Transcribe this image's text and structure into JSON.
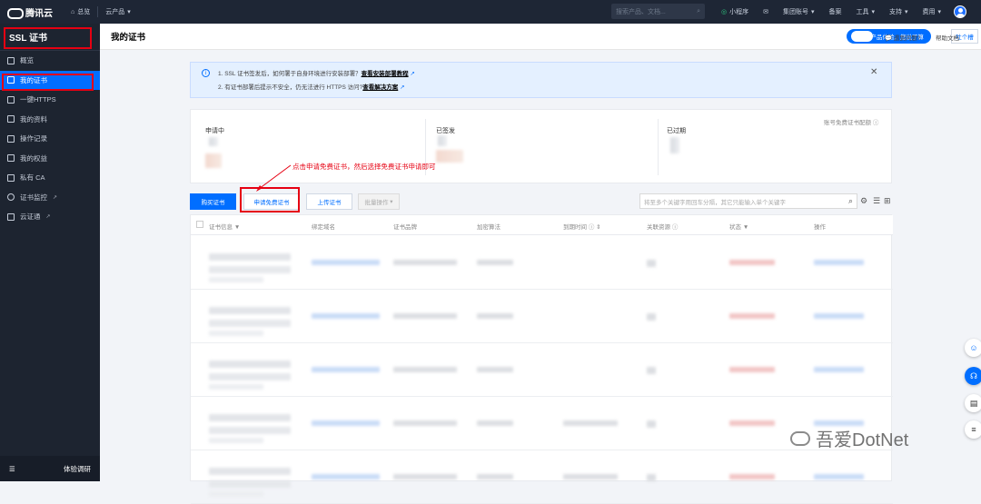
{
  "topbar": {
    "brand": "腾讯云",
    "overview": "总览",
    "products": "云产品",
    "search_placeholder": "搜索产品、文档...",
    "mini_program": "小程序",
    "team_account": "集团账号",
    "record": "备案",
    "tools": "工具",
    "support": "支持",
    "billing": "费用"
  },
  "sidebar": {
    "title": "SSL 证书",
    "items": [
      {
        "label": "概览"
      },
      {
        "label": "我的证书"
      },
      {
        "label": "一键HTTPS"
      },
      {
        "label": "我的资料"
      },
      {
        "label": "操作记录"
      },
      {
        "label": "我的权益"
      },
      {
        "label": "私有 CA"
      },
      {
        "label": "证书监控"
      },
      {
        "label": "云证通"
      }
    ],
    "bottom_label": "体验调研"
  },
  "header": {
    "title": "我的证书",
    "promo": "产品体验，您说了算",
    "tucao": "吐个槽",
    "question": "遇到问题?",
    "help": "帮助文档"
  },
  "notice": {
    "line1": "1. SSL 证书签发后，如何署于自身环境进行安装部署？",
    "line1_link": "查看安装部署教程",
    "line2": "2. 有证书部署后提示不安全，仍无法进行 HTTPS 访问?",
    "line2_link": "查看解决方案"
  },
  "stats": {
    "applying": "申请中",
    "issued": "已签发",
    "expired": "已过期",
    "quota_link": "账号免费证书配额"
  },
  "toolbar": {
    "buy": "购买证书",
    "apply_free": "申请免费证书",
    "upload": "上传证书",
    "batch": "批量操作",
    "search_placeholder": "将至多个关键字用回车分隔，其它只能输入单个关键字"
  },
  "table": {
    "headers": [
      "证书信息",
      "绑定域名",
      "证书品牌",
      "加密算法",
      "到期时间",
      "关联资源",
      "状态",
      "操作"
    ]
  },
  "annotation": "点击申请免费证书，然后选择免费证书申请即可",
  "watermark": "吾爱DotNet",
  "colors": {
    "accent": "#006eff",
    "annotation": "#e60012",
    "sidebar": "#1d2430"
  }
}
